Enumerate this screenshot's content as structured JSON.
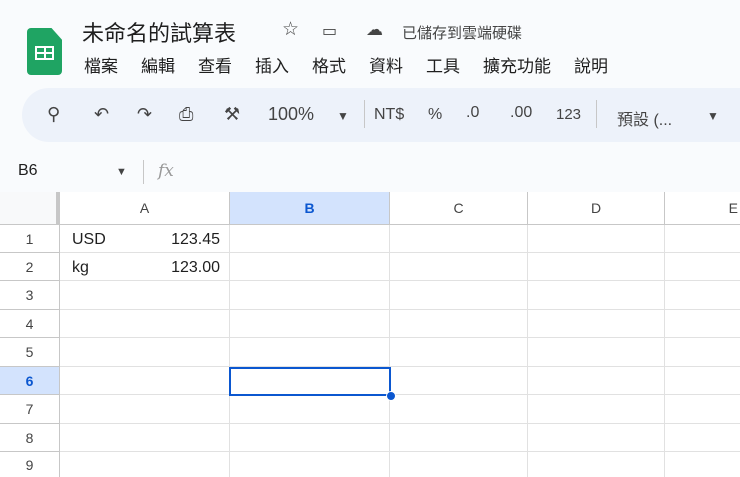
{
  "app": {
    "title": "未命名的試算表",
    "saved_status": "已儲存到雲端硬碟"
  },
  "menu": [
    "檔案",
    "編輯",
    "查看",
    "插入",
    "格式",
    "資料",
    "工具",
    "擴充功能",
    "說明"
  ],
  "toolbar": {
    "zoom": "100%",
    "currency": "NT$",
    "percent": "%",
    "decrease_decimal": ".0",
    "increase_decimal": ".00",
    "number_format": "123",
    "font": "預設 (..."
  },
  "formula_bar": {
    "name_box": "B6",
    "fx": "fx",
    "value": ""
  },
  "columns": [
    "A",
    "B",
    "C",
    "D",
    "E"
  ],
  "rows": [
    "1",
    "2",
    "3",
    "4",
    "5",
    "6",
    "7",
    "8",
    "9"
  ],
  "cells": {
    "A1_label": "USD",
    "A1_value": "123.45",
    "A2_label": "kg",
    "A2_value": "123.00"
  },
  "selected_cell": "B6",
  "colors": {
    "accent": "#0b57d0",
    "selected_header": "#d3e3fd",
    "logo": "#1fa463"
  }
}
